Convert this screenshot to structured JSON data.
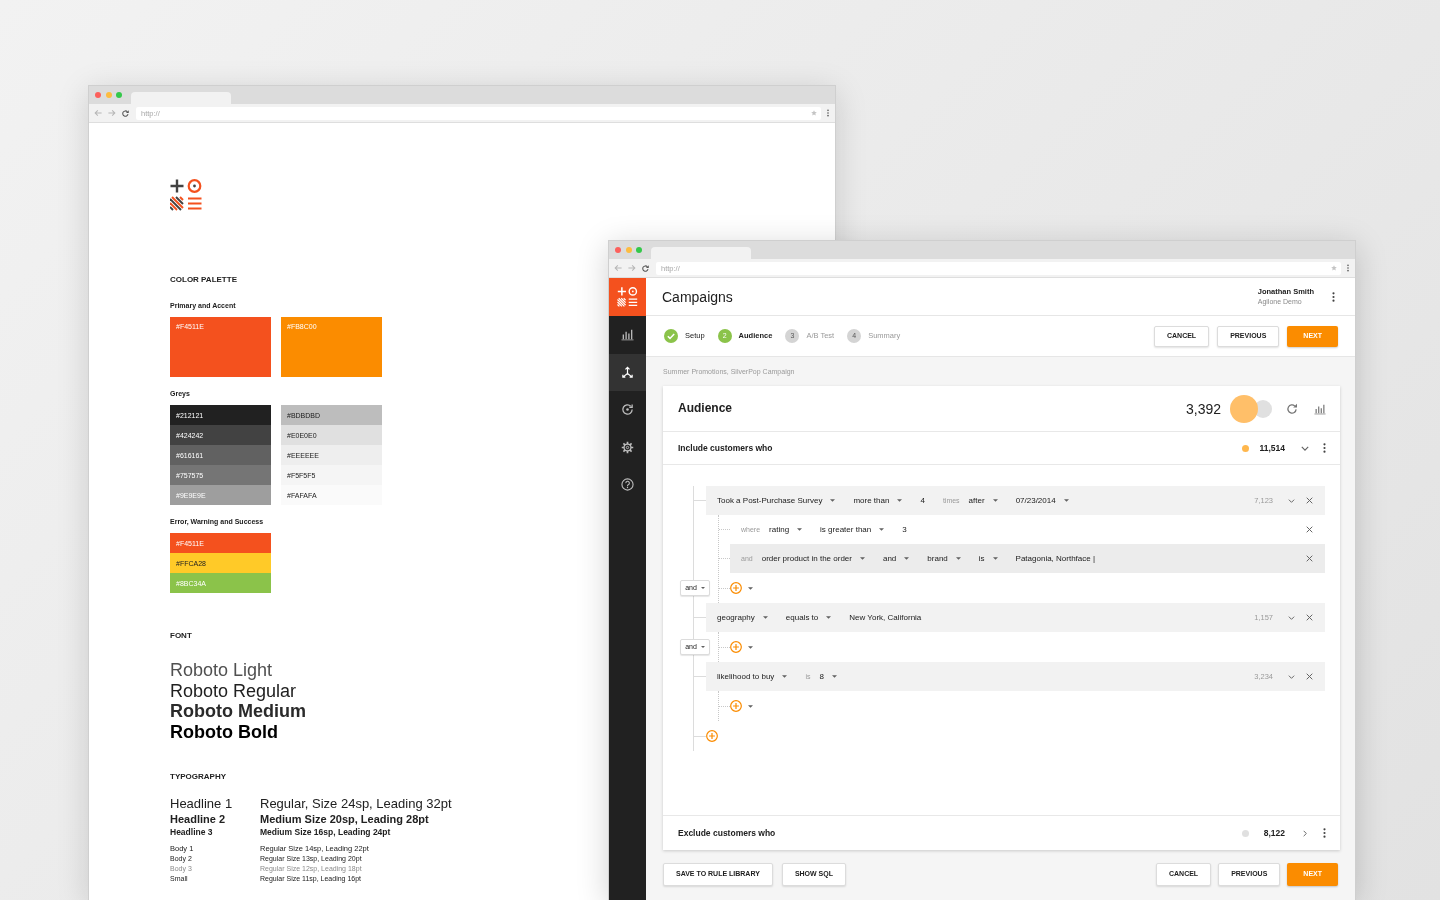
{
  "style_guide_window": {
    "address_bar": {
      "placeholder": "http://"
    },
    "color_palette": {
      "title": "COLOR PALETTE",
      "groups": [
        {
          "label": "Primary and Accent",
          "columns": [
            [
              {
                "label": "#F4511E",
                "color": "#f4511e"
              }
            ],
            [
              {
                "label": "#FB8C00",
                "color": "#fb8c00"
              }
            ]
          ]
        },
        {
          "label": "Greys",
          "columns": [
            [
              {
                "label": "#212121",
                "color": "#212121"
              },
              {
                "label": "#424242",
                "color": "#424242"
              },
              {
                "label": "#616161",
                "color": "#616161"
              },
              {
                "label": "#757575",
                "color": "#757575"
              },
              {
                "label": "#9E9E9E",
                "color": "#9e9e9e"
              }
            ],
            [
              {
                "label": "#BDBDBD",
                "color": "#bdbdbd"
              },
              {
                "label": "#E0E0E0",
                "color": "#e0e0e0"
              },
              {
                "label": "#EEEEEE",
                "color": "#eeeeee"
              },
              {
                "label": "#F5F5F5",
                "color": "#f5f5f5"
              },
              {
                "label": "#FAFAFA",
                "color": "#fafafa"
              }
            ]
          ]
        },
        {
          "label": "Error, Warning and Success",
          "columns": [
            [
              {
                "label": "#F4511E",
                "color": "#f4511e"
              },
              {
                "label": "#FFCA28",
                "color": "#ffca28"
              },
              {
                "label": "#8BC34A",
                "color": "#8bc34a"
              }
            ]
          ]
        }
      ]
    },
    "font": {
      "title": "FONT",
      "samples": [
        {
          "text": "Roboto Light",
          "kind": "light"
        },
        {
          "text": "Roboto Regular",
          "kind": "regular"
        },
        {
          "text": "Roboto Medium",
          "kind": "medium"
        },
        {
          "text": "Roboto Bold",
          "kind": "bold"
        }
      ]
    },
    "typography": {
      "title": "TYPOGRAPHY",
      "groups": [
        [
          {
            "kind": "headline1",
            "name": "Headline 1",
            "spec": "Regular, Size 24sp, Leading 32pt"
          },
          {
            "kind": "headline2",
            "name": "Headline 2",
            "spec": "Medium Size 20sp, Leading 28pt"
          },
          {
            "kind": "headline3",
            "name": "Headline 3",
            "spec": "Medium Size 16sp, Leading 24pt"
          }
        ],
        [
          {
            "kind": "body1",
            "name": "Body 1",
            "spec": "Regular Size 14sp, Leading 22pt"
          },
          {
            "kind": "body2",
            "name": "Body 2",
            "spec": "Regular Size 13sp, Leading 20pt"
          },
          {
            "kind": "body3",
            "name": "Body 3",
            "spec": "Regular Size 12sp, Leading 18pt"
          },
          {
            "kind": "small",
            "name": "Small",
            "spec": "Regular Size 11sp, Leading 16pt"
          }
        ]
      ]
    }
  },
  "campaign_window": {
    "address_bar": {
      "placeholder": "http://"
    },
    "sidebar": {
      "items": [
        {
          "selected": false
        },
        {
          "selected": true
        },
        {
          "selected": false
        },
        {
          "selected": false
        },
        {
          "selected": false
        }
      ]
    },
    "header": {
      "title": "Campaigns",
      "user_name": "Jonathan Smith",
      "organization": "Agilone Demo"
    },
    "steps": [
      {
        "label": "Setup",
        "completed": true,
        "selected": false
      },
      {
        "number": "2",
        "label": "Audience",
        "completed": false,
        "selected": true
      },
      {
        "number": "3",
        "label": "A/B Test",
        "completed": false,
        "selected": false
      },
      {
        "number": "4",
        "label": "Summary",
        "completed": false,
        "selected": false
      }
    ],
    "top_buttons": [
      {
        "label": "CANCEL",
        "kind": "secondary"
      },
      {
        "label": "PREVIOUS",
        "kind": "secondary"
      },
      {
        "label": "NEXT",
        "kind": "primary"
      }
    ],
    "breadcrumb": "Summer Promotions, SilverPop Campaign",
    "audience_card": {
      "title": "Audience",
      "count": "3,392",
      "switch": {
        "on": true
      },
      "include": {
        "label": "Include customers who",
        "color": "#ffb74d",
        "count": "11,514",
        "expanded": true
      },
      "rules": [
        {
          "tokens": [
            {
              "kind": "dropdown",
              "text": "Took a Post-Purchase Survey"
            },
            {
              "kind": "dropdown",
              "text": "more than"
            },
            {
              "kind": "value",
              "text": "4"
            },
            {
              "kind": "label",
              "text": "times"
            },
            {
              "kind": "dropdown",
              "text": "after"
            },
            {
              "kind": "dropdown",
              "text": "07/23/2014"
            }
          ],
          "count": "7,123",
          "conditions": [
            {
              "highlighted": false,
              "tokens": [
                {
                  "kind": "label",
                  "text": "where"
                },
                {
                  "kind": "dropdown",
                  "text": "rating"
                },
                {
                  "kind": "dropdown",
                  "text": "is greater than"
                },
                {
                  "kind": "value",
                  "text": "3"
                }
              ]
            },
            {
              "highlighted": true,
              "tokens": [
                {
                  "kind": "label",
                  "text": "and"
                },
                {
                  "kind": "dropdown",
                  "text": "order product in the order"
                },
                {
                  "kind": "dropdown",
                  "text": "and"
                },
                {
                  "kind": "dropdown",
                  "text": "brand"
                },
                {
                  "kind": "dropdown",
                  "text": "is"
                },
                {
                  "kind": "value",
                  "text": "Patagonia, Northface |"
                }
              ]
            }
          ],
          "joiner": "and"
        },
        {
          "tokens": [
            {
              "kind": "dropdown",
              "text": "geography"
            },
            {
              "kind": "dropdown",
              "text": "equals to"
            },
            {
              "kind": "value",
              "text": "New York, California"
            }
          ],
          "count": "1,157",
          "joiner": "and"
        },
        {
          "tokens": [
            {
              "kind": "dropdown",
              "text": "likelihood to buy"
            },
            {
              "kind": "label",
              "text": "is"
            },
            {
              "kind": "dropdown",
              "text": "8"
            }
          ],
          "count": "3,234"
        }
      ],
      "exclude": {
        "label": "Exclude customers who",
        "color": "#e0e0e0",
        "count": "8,122",
        "expanded": false
      }
    },
    "bottom_buttons": {
      "left": [
        {
          "label": "SAVE TO RULE LIBRARY",
          "kind": "secondary"
        },
        {
          "label": "SHOW SQL",
          "kind": "secondary"
        }
      ],
      "right": [
        {
          "label": "CANCEL",
          "kind": "secondary"
        },
        {
          "label": "PREVIOUS",
          "kind": "secondary"
        },
        {
          "label": "NEXT",
          "kind": "primary"
        }
      ]
    }
  }
}
